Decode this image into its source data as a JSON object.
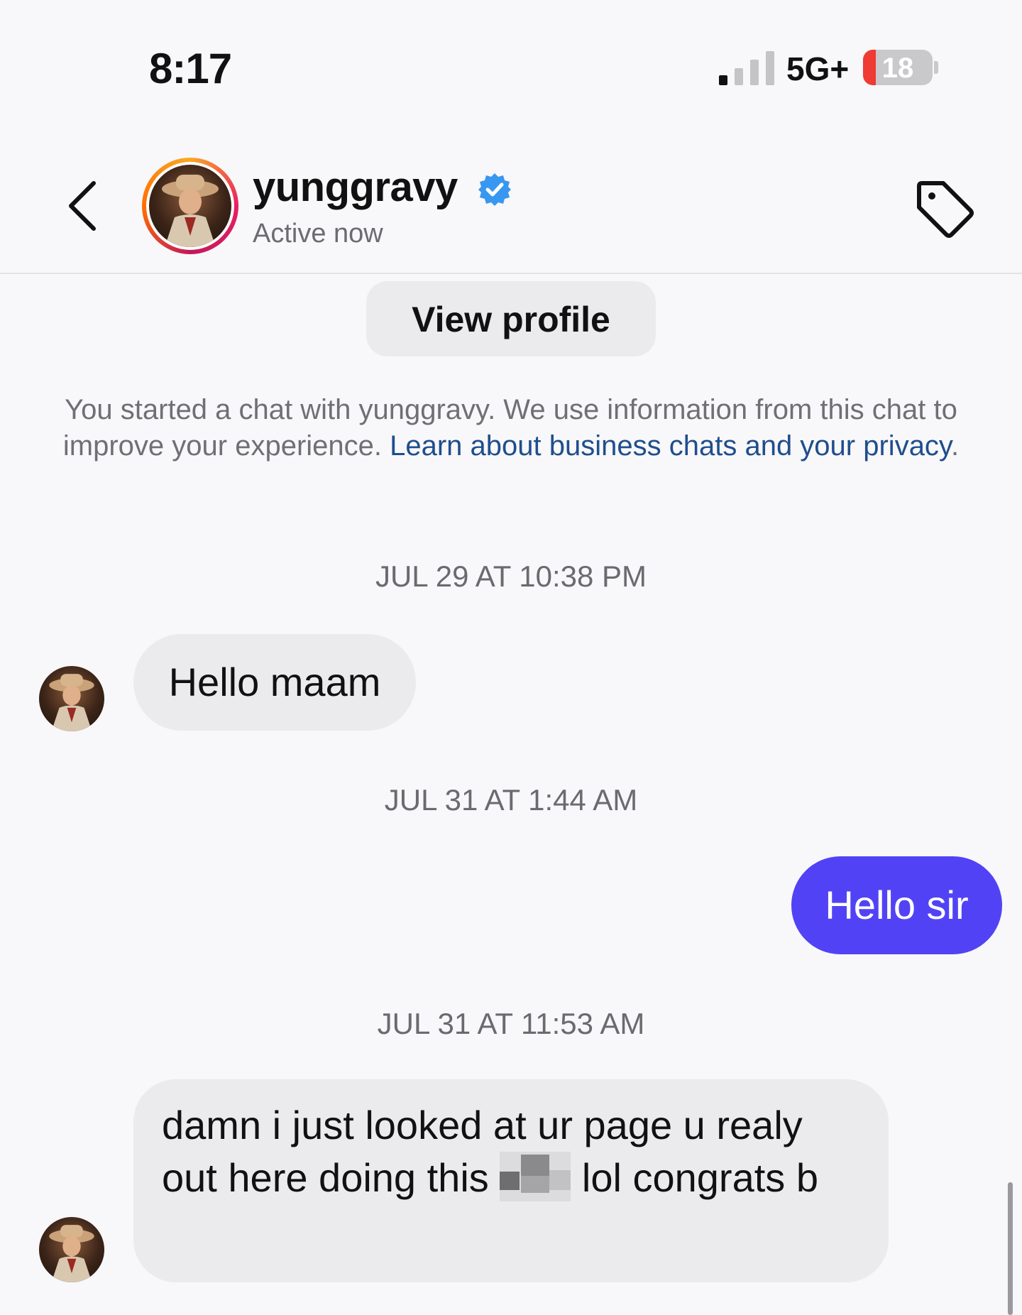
{
  "status_bar": {
    "time": "8:17",
    "network": "5G+",
    "battery": "18",
    "battery_level": 0.18
  },
  "header": {
    "username": "yunggravy",
    "status": "Active now",
    "back_icon": "chevron-left-icon",
    "tag_icon": "tag-icon",
    "verified_icon": "verified-badge-icon"
  },
  "view_profile_label": "View profile",
  "notice": {
    "text": "You started a chat with yunggravy. We use information from this chat to improve your experience. ",
    "link": "Learn about business chats and your privacy",
    "end": "."
  },
  "messages": [
    {
      "timestamp": "JUL 29 AT 10:38 PM",
      "from": "them",
      "text": "Hello maam"
    },
    {
      "timestamp": "JUL 31 AT 1:44 AM",
      "from": "me",
      "text": "Hello sir"
    },
    {
      "timestamp": "JUL 31 AT 11:53 AM",
      "from": "them",
      "text_before": "damn i just looked at ur page u realy out here doing this",
      "text_after": "lol congrats b"
    }
  ],
  "colors": {
    "outgoing_bubble": "#5143f5",
    "incoming_bubble": "#ebeaed",
    "link": "#1f4e8c"
  }
}
